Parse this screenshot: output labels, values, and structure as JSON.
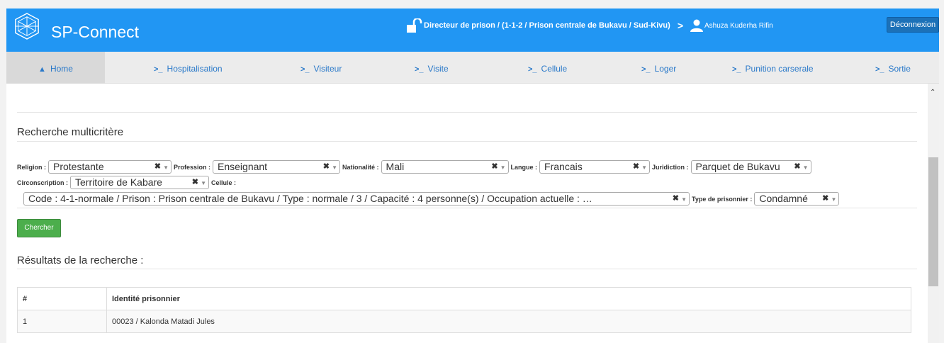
{
  "header": {
    "brand": "SP-Connect",
    "role": "Directeur de prison / (1-1-2 / Prison centrale de Bukavu / Sud-Kivu)",
    "user": "Ashuza Kuderha Rifin",
    "logout": "Déconnexion"
  },
  "nav": [
    {
      "label": "Home",
      "icon": "home-icon"
    },
    {
      "label": "Hospitalisation",
      "icon": "prompt-icon"
    },
    {
      "label": "Visiteur",
      "icon": "prompt-icon"
    },
    {
      "label": "Visite",
      "icon": "prompt-icon"
    },
    {
      "label": "Cellule",
      "icon": "prompt-icon"
    },
    {
      "label": "Loger",
      "icon": "prompt-icon"
    },
    {
      "label": "Punition carserale",
      "icon": "prompt-icon"
    },
    {
      "label": "Sortie",
      "icon": "prompt-icon"
    }
  ],
  "search": {
    "title": "Recherche multicritère",
    "filters": {
      "religion": {
        "label": "Religion :",
        "value": "Protestante"
      },
      "profession": {
        "label": "Profession :",
        "value": "Enseignant"
      },
      "nationalite": {
        "label": "Nationalité :",
        "value": "Mali"
      },
      "langue": {
        "label": "Langue :",
        "value": "Francais"
      },
      "juridiction": {
        "label": "Juridiction :",
        "value": "Parquet de Bukavu"
      },
      "circonscription": {
        "label": "Circonscription :",
        "value": "Territoire de Kabare"
      },
      "cellule": {
        "label": "Cellule :",
        "value": "Code : 4-1-normale / Prison : Prison centrale de Bukavu / Type : normale / 3 / Capacité : 4 personne(s) / Occupation actuelle : …"
      },
      "type_prisonnier": {
        "label": "Type de prisonnier :",
        "value": "Condamné"
      }
    },
    "button": "Chercher"
  },
  "results": {
    "title": "Résultats de la recherche :",
    "columns": [
      "#",
      "Identité prisonnier"
    ],
    "rows": [
      [
        "1",
        "00023 / Kalonda Matadi Jules"
      ]
    ]
  }
}
